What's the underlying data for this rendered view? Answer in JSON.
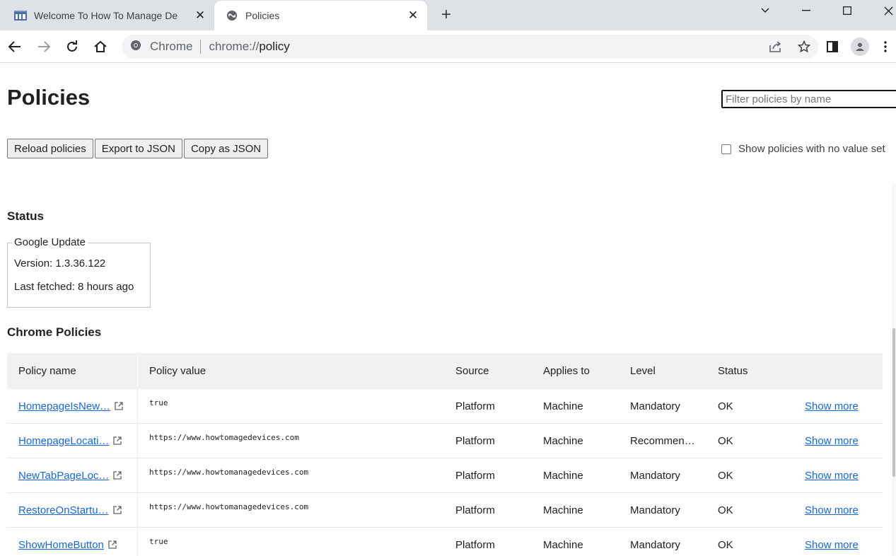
{
  "browser": {
    "tabs": [
      {
        "title": "Welcome To How To Manage De",
        "favicon": "site-icon",
        "active": false
      },
      {
        "title": "Policies",
        "favicon": "globe-icon",
        "active": true
      }
    ],
    "new_tab": "+",
    "omnibox": {
      "site_label": "Chrome",
      "url_scheme": "chrome://",
      "url_host": "policy"
    }
  },
  "page": {
    "title": "Policies",
    "filter_placeholder": "Filter policies by name",
    "buttons": {
      "reload": "Reload policies",
      "export": "Export to JSON",
      "copy": "Copy as JSON"
    },
    "show_no_value": "Show policies with no value set",
    "status": {
      "heading": "Status",
      "box_title": "Google Update",
      "version": "Version: 1.3.36.122",
      "last_fetched": "Last fetched: 8 hours ago"
    },
    "chrome_policies": {
      "heading": "Chrome Policies",
      "columns": [
        "Policy name",
        "Policy value",
        "Source",
        "Applies to",
        "Level",
        "Status"
      ],
      "rows": [
        {
          "name": "HomepageIsNew…",
          "value": "true",
          "source": "Platform",
          "applies": "Machine",
          "level": "Mandatory",
          "status": "OK",
          "more": "Show more"
        },
        {
          "name": "HomepageLocati…",
          "value": "https://www.howtomagedevices.com",
          "source": "Platform",
          "applies": "Machine",
          "level": "Recommen…",
          "status": "OK",
          "more": "Show more"
        },
        {
          "name": "NewTabPageLoc…",
          "value": "https://www.howtomanagedevices.com",
          "source": "Platform",
          "applies": "Machine",
          "level": "Mandatory",
          "status": "OK",
          "more": "Show more"
        },
        {
          "name": "RestoreOnStartu…",
          "value": "https://www.howtomanagedevices.com",
          "source": "Platform",
          "applies": "Machine",
          "level": "Mandatory",
          "status": "OK",
          "more": "Show more"
        },
        {
          "name": "ShowHomeButton",
          "value": "true",
          "source": "Platform",
          "applies": "Machine",
          "level": "Mandatory",
          "status": "OK",
          "more": "Show more"
        }
      ]
    }
  }
}
